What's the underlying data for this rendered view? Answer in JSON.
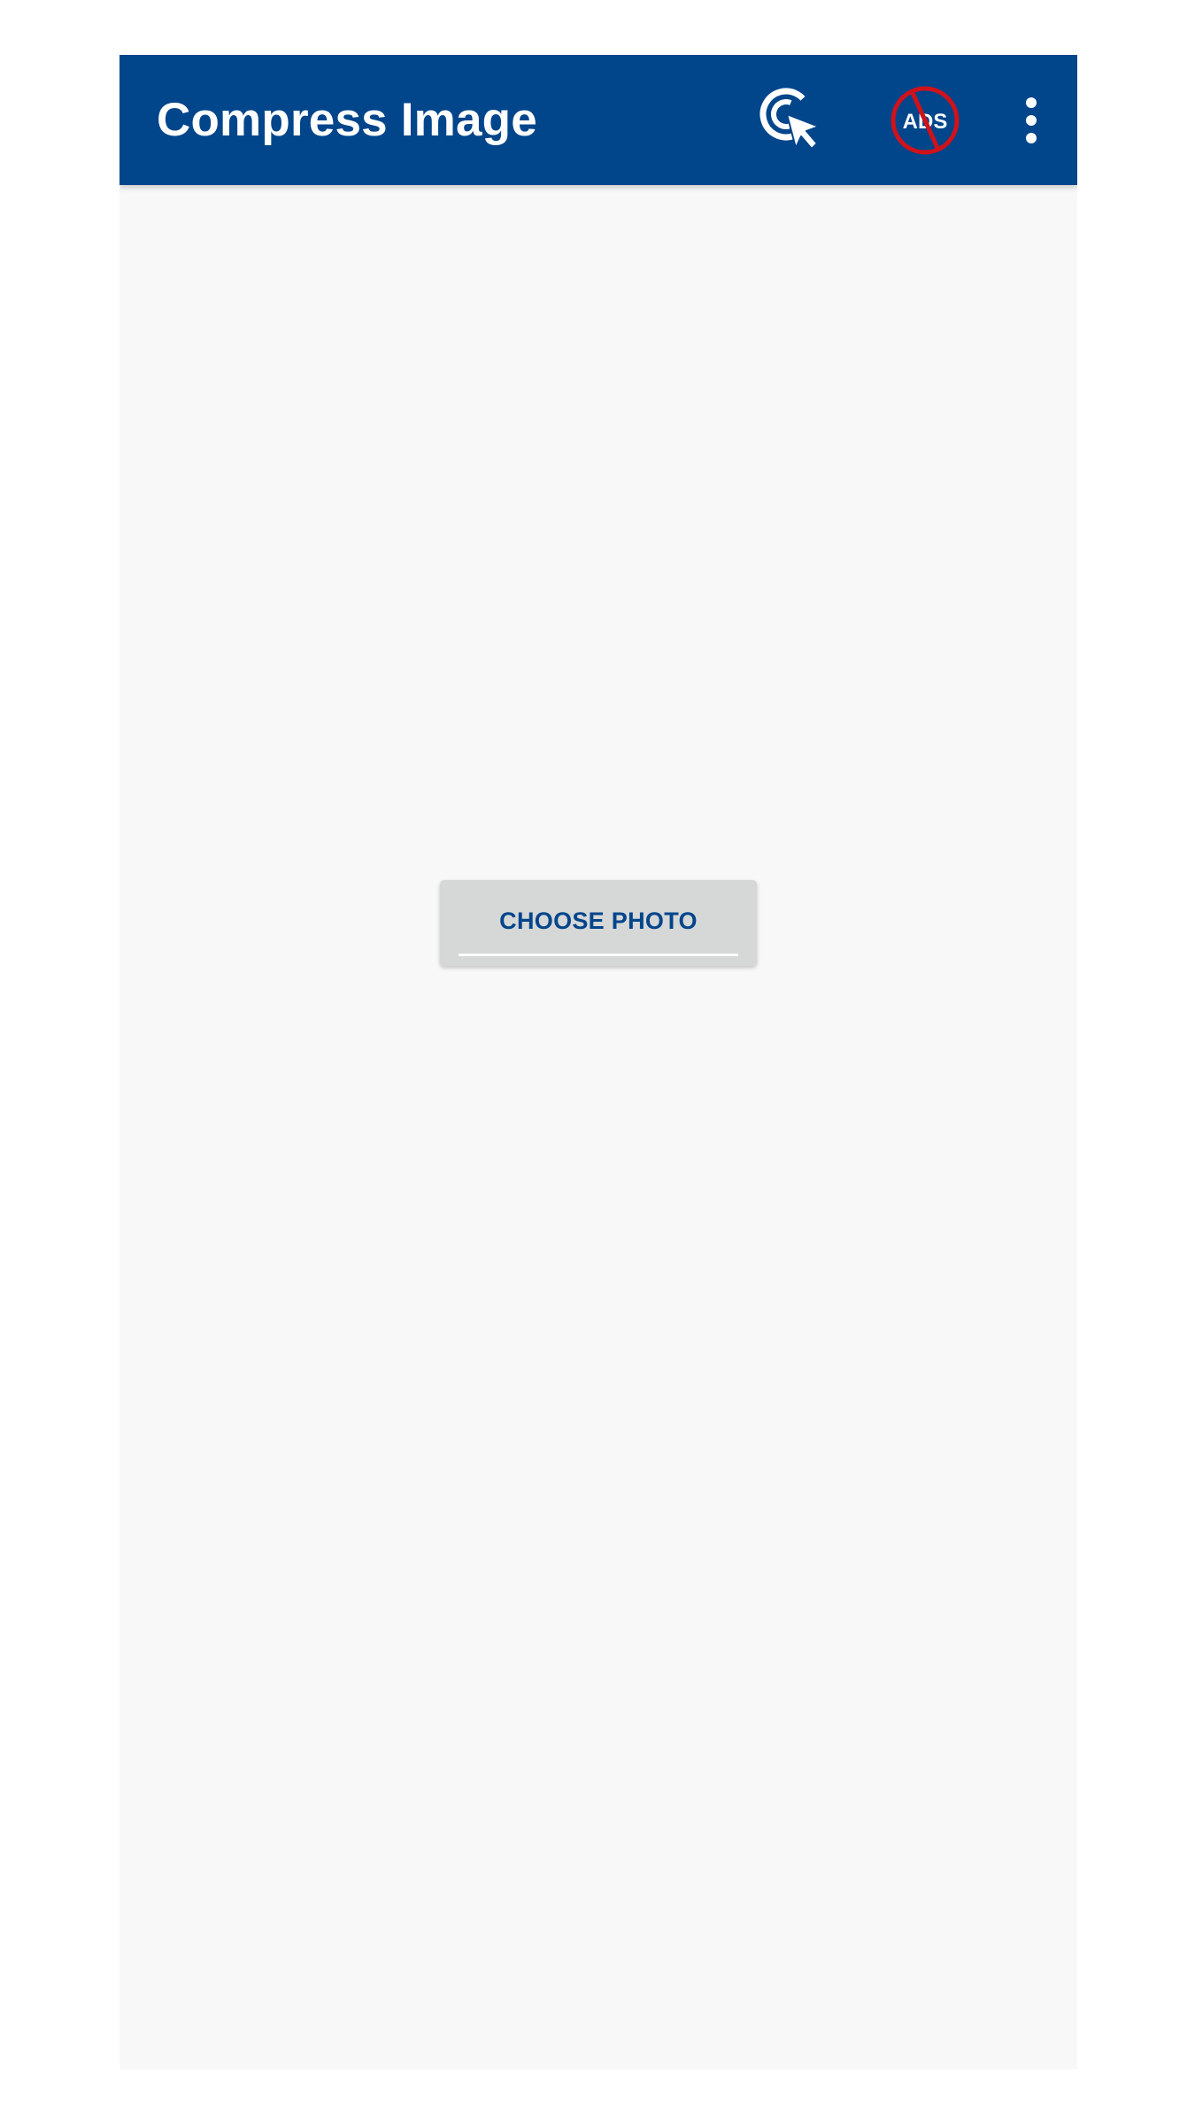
{
  "app_bar": {
    "title": "Compress Image",
    "background_color": "#01458b",
    "actions": [
      {
        "name": "click-cursor-icon"
      },
      {
        "name": "no-ads-icon",
        "text": "ADS",
        "accent_color": "#d0121b"
      },
      {
        "name": "overflow-menu-icon"
      }
    ]
  },
  "main": {
    "background_color": "#f8f8f8",
    "choose_photo_button": {
      "label": "CHOOSE PHOTO",
      "text_color": "#01458b",
      "background_color": "#d6d7d7"
    }
  }
}
